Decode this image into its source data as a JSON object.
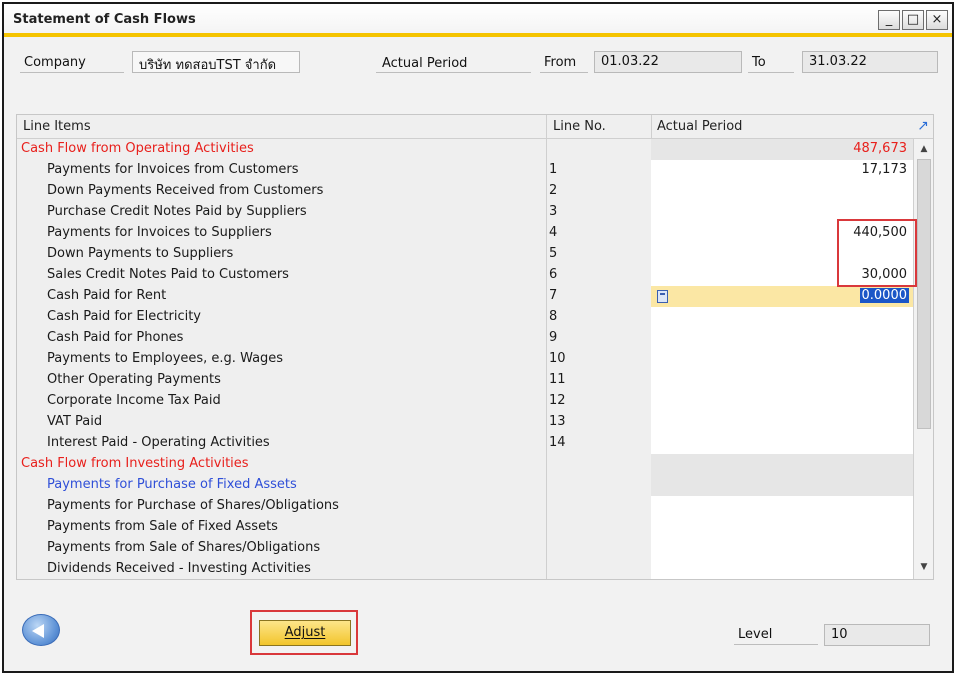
{
  "window": {
    "title": "Statement of Cash Flows",
    "controls": [
      "_",
      "□",
      "×"
    ]
  },
  "header": {
    "company_label": "Company",
    "company_value": "บริษัท ทดสอบTST จำกัด",
    "period_label": "Actual Period",
    "from_label": "From",
    "from_value": "01.03.22",
    "to_label": "To",
    "to_value": "31.03.22"
  },
  "grid": {
    "columns": [
      "Line Items",
      "Line No.",
      "Actual Period"
    ],
    "rows": [
      {
        "name": "Cash Flow from Operating Activities",
        "no": "",
        "value": "487,673"
      },
      {
        "name": "Payments for Invoices from Customers",
        "no": "1",
        "value": "17,173"
      },
      {
        "name": "Down Payments Received from Customers",
        "no": "2",
        "value": ""
      },
      {
        "name": "Purchase Credit Notes Paid by Suppliers",
        "no": "3",
        "value": ""
      },
      {
        "name": "Payments for Invoices to Suppliers",
        "no": "4",
        "value": "440,500"
      },
      {
        "name": "Down Payments to Suppliers",
        "no": "5",
        "value": ""
      },
      {
        "name": "Sales Credit Notes Paid to Customers",
        "no": "6",
        "value": "30,000"
      },
      {
        "name": "Cash Paid for Rent",
        "no": "7",
        "value": "0.0000"
      },
      {
        "name": "Cash Paid for Electricity",
        "no": "8",
        "value": ""
      },
      {
        "name": "Cash Paid for Phones",
        "no": "9",
        "value": ""
      },
      {
        "name": "Payments to Employees, e.g. Wages",
        "no": "10",
        "value": ""
      },
      {
        "name": "Other Operating Payments",
        "no": "11",
        "value": ""
      },
      {
        "name": "Corporate Income Tax Paid",
        "no": "12",
        "value": ""
      },
      {
        "name": "VAT Paid",
        "no": "13",
        "value": ""
      },
      {
        "name": "Interest Paid - Operating Activities",
        "no": "14",
        "value": ""
      },
      {
        "name": "Cash Flow from Investing Activities",
        "no": "",
        "value": ""
      },
      {
        "name": "Payments for Purchase of Fixed Assets",
        "no": "",
        "value": ""
      },
      {
        "name": "Payments for Purchase of Shares/Obligations",
        "no": "",
        "value": ""
      },
      {
        "name": "Payments from Sale of Fixed Assets",
        "no": "",
        "value": ""
      },
      {
        "name": "Payments from Sale of Shares/Obligations",
        "no": "",
        "value": ""
      },
      {
        "name": "Dividends Received - Investing Activities",
        "no": "",
        "value": ""
      }
    ]
  },
  "footer": {
    "adjust_label": "Adjust",
    "level_label": "Level",
    "level_value": "10"
  },
  "colors": {
    "accent": "#f5c400",
    "section_red": "#e8201c",
    "link_blue": "#2f4fd8",
    "highlight_red": "#d9383b",
    "edit_yellow": "#fbe7a4"
  }
}
